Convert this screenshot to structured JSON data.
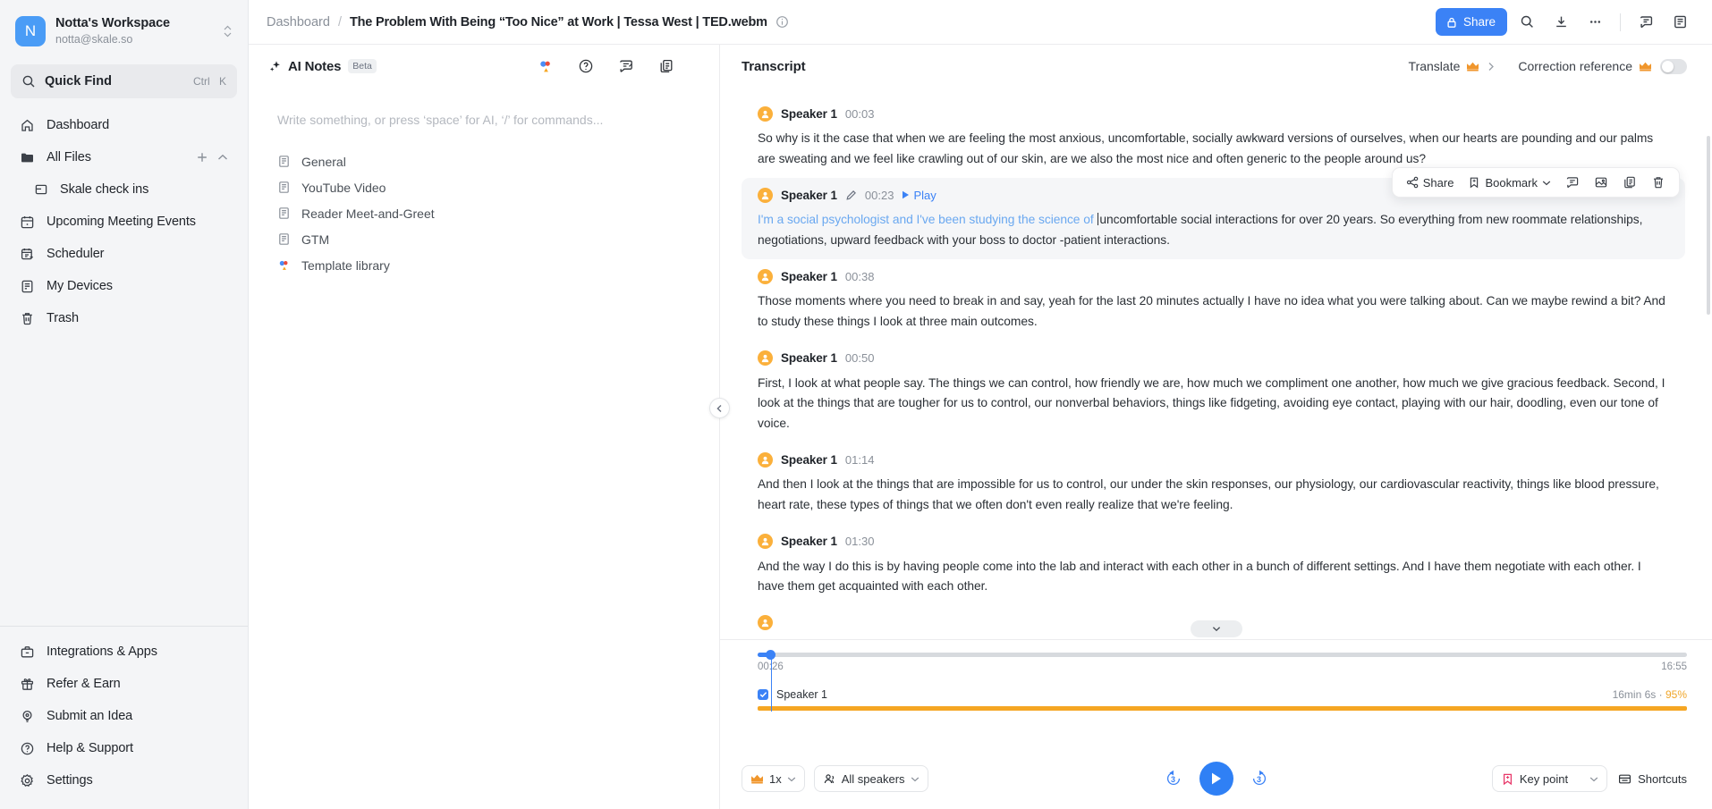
{
  "sidebar": {
    "workspace": {
      "avatar_letter": "N",
      "name": "Notta's Workspace",
      "email": "notta@skale.so"
    },
    "quick_find": {
      "label": "Quick Find",
      "shortcut_mod": "Ctrl",
      "shortcut_key": "K"
    },
    "items": [
      {
        "label": "Dashboard",
        "icon": "home-icon"
      },
      {
        "label": "All Files",
        "icon": "folder-icon"
      },
      {
        "label": "Skale check ins",
        "icon": "folder-sub-icon"
      },
      {
        "label": "Upcoming Meeting Events",
        "icon": "calendar-icon"
      },
      {
        "label": "Scheduler",
        "icon": "calendar-plus-icon"
      },
      {
        "label": "My Devices",
        "icon": "device-icon"
      },
      {
        "label": "Trash",
        "icon": "trash-icon"
      }
    ],
    "bottom_items": [
      {
        "label": "Integrations & Apps",
        "icon": "briefcase-icon"
      },
      {
        "label": "Refer & Earn",
        "icon": "gift-icon"
      },
      {
        "label": "Submit an Idea",
        "icon": "bulb-icon"
      },
      {
        "label": "Help & Support",
        "icon": "help-circle-icon"
      },
      {
        "label": "Settings",
        "icon": "gear-icon"
      }
    ]
  },
  "topbar": {
    "breadcrumb_root": "Dashboard",
    "breadcrumb_sep": "/",
    "title": "The Problem With Being “Too Nice” at Work | Tessa West | TED.webm",
    "share_label": "Share",
    "icons": [
      "search-icon",
      "download-icon",
      "more-icon",
      "comment-icon",
      "panel-icon"
    ]
  },
  "notes": {
    "title": "AI Notes",
    "badge": "Beta",
    "header_icons": [
      "template-library-icon",
      "help-circle-icon",
      "feedback-icon",
      "copy-icon"
    ],
    "placeholder": "Write something, or press ‘space’ for AI, ‘/’ for commands...",
    "items": [
      {
        "label": "General",
        "icon": "doc-icon"
      },
      {
        "label": "YouTube Video",
        "icon": "doc-icon"
      },
      {
        "label": "Reader Meet-and-Greet",
        "icon": "doc-icon"
      },
      {
        "label": "GTM",
        "icon": "doc-icon"
      },
      {
        "label": "Template library",
        "icon": "template-library-icon"
      }
    ]
  },
  "transcript": {
    "title": "Transcript",
    "translate_label": "Translate",
    "correction_label": "Correction reference",
    "toolbar": {
      "share": "Share",
      "bookmark": "Bookmark",
      "icons": [
        "comment-icon",
        "image-icon",
        "copy-icon",
        "trash-icon"
      ]
    },
    "play_label": "Play",
    "segments": [
      {
        "speaker": "Speaker 1",
        "time": "00:03",
        "active": false,
        "text": "So why is it the case that when we are feeling the most anxious, uncomfortable, socially awkward versions of ourselves, when our hearts are pounding and our palms are sweating and we feel like crawling out of our skin, are we also the most nice and often generic to the people around us?"
      },
      {
        "speaker": "Speaker 1",
        "time": "00:23",
        "active": true,
        "text_highlighted": "I'm a social psychologist and I've been studying the science of ",
        "text_rest": "uncomfortable social interactions for over 20 years. So everything from new roommate relationships, negotiations, upward feedback with your boss to doctor -patient interactions."
      },
      {
        "speaker": "Speaker 1",
        "time": "00:38",
        "active": false,
        "text": "Those moments where you need to break in and say, yeah for the last 20 minutes actually I have no idea what you were talking about. Can we maybe rewind a bit? And to study these things I look at three main outcomes."
      },
      {
        "speaker": "Speaker 1",
        "time": "00:50",
        "active": false,
        "text": "First, I look at what people say. The things we can control, how friendly we are, how much we compliment one another, how much we give gracious feedback. Second, I look at the things that are tougher for us to control, our nonverbal behaviors, things like fidgeting, avoiding eye contact, playing with our hair, doodling, even our tone of voice."
      },
      {
        "speaker": "Speaker 1",
        "time": "01:14",
        "active": false,
        "text": "And then I look at the things that are impossible for us to control, our under the skin responses, our physiology, our cardiovascular reactivity, things like blood pressure, heart rate, these types of things that we often don't even really realize that we're feeling."
      },
      {
        "speaker": "Speaker 1",
        "time": "01:30",
        "active": false,
        "text": "And the way I do this is by having people come into the lab and interact with each other in a bunch of different settings. And I have them negotiate with each other. I have them get acquainted with each other."
      }
    ]
  },
  "player": {
    "current_time": "00:26",
    "total_time": "16:55",
    "speaker_track": {
      "name": "Speaker 1",
      "meta_duration": "16min 6s",
      "meta_sep": "·",
      "meta_percent": "95%"
    },
    "speed_label": "1x",
    "speakers_label": "All speakers",
    "skip_back": "3",
    "skip_forward": "3",
    "key_point_label": "Key point",
    "shortcuts_label": "Shortcuts"
  }
}
